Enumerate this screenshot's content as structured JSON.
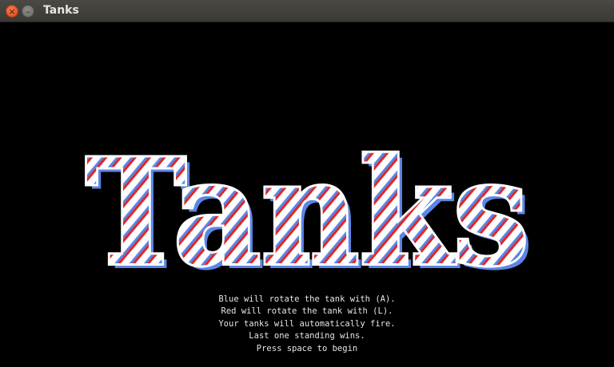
{
  "window": {
    "title": "Tanks",
    "close_glyph": "×",
    "minimize_glyph": "–"
  },
  "logo": {
    "text": "Tanks",
    "colors": {
      "blue": "#5b86e5",
      "red": "#e02828",
      "white": "#ffffff"
    }
  },
  "instructions": {
    "line1": "Blue will rotate the tank with (A).",
    "line2": "Red will rotate the tank with (L).",
    "line3": "Your tanks will automatically fire.",
    "line4": "Last one standing wins.",
    "line5": "Press space to begin"
  }
}
